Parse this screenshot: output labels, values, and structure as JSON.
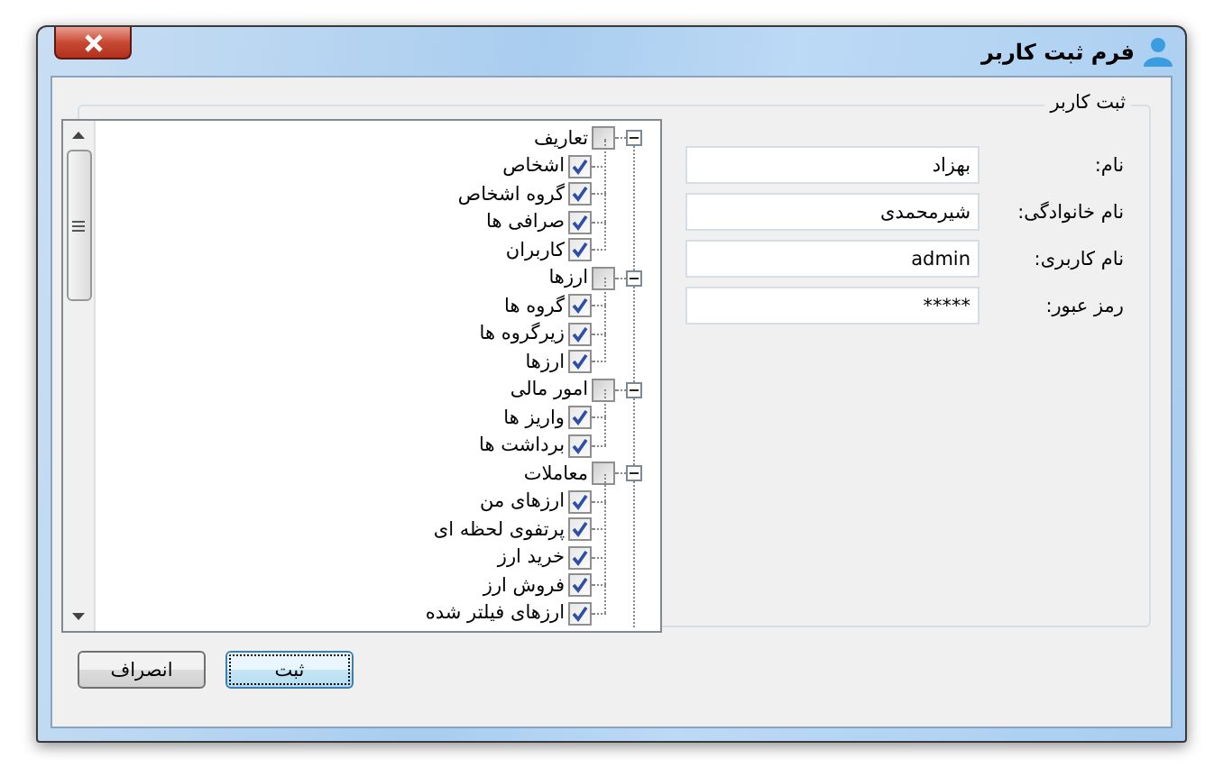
{
  "window": {
    "title": "فرم ثبت کاربر"
  },
  "group": {
    "title": "ثبت کاربر"
  },
  "fields": [
    {
      "label": "نام:",
      "value": "بهزاد"
    },
    {
      "label": "نام خانوادگی:",
      "value": "شیرمحمدی"
    },
    {
      "label": "نام کاربری:",
      "value": "admin"
    },
    {
      "label": "رمز عبور:",
      "value": "*****"
    }
  ],
  "tree": [
    {
      "label": "تعاریف",
      "checked": false,
      "expanded": true,
      "children": [
        {
          "label": "اشخاص",
          "checked": true
        },
        {
          "label": "گروه اشخاص",
          "checked": true
        },
        {
          "label": "صرافی ها",
          "checked": true
        },
        {
          "label": "کاربران",
          "checked": true
        }
      ]
    },
    {
      "label": "ارزها",
      "checked": false,
      "expanded": true,
      "children": [
        {
          "label": "گروه ها",
          "checked": true
        },
        {
          "label": "زیرگروه ها",
          "checked": true
        },
        {
          "label": "ارزها",
          "checked": true
        }
      ]
    },
    {
      "label": "امور مالی",
      "checked": false,
      "expanded": true,
      "children": [
        {
          "label": "واریز ها",
          "checked": true
        },
        {
          "label": "برداشت ها",
          "checked": true
        }
      ]
    },
    {
      "label": "معاملات",
      "checked": false,
      "expanded": true,
      "children": [
        {
          "label": "ارزهای من",
          "checked": true
        },
        {
          "label": "پرتفوی لحظه ای",
          "checked": true
        },
        {
          "label": "خرید ارز",
          "checked": true
        },
        {
          "label": "فروش ارز",
          "checked": true
        },
        {
          "label": "ارزهای فیلتر شده",
          "checked": true
        }
      ]
    }
  ],
  "buttons": [
    {
      "label": "ثبت",
      "focused": true
    },
    {
      "label": "انصراف",
      "focused": false
    }
  ]
}
